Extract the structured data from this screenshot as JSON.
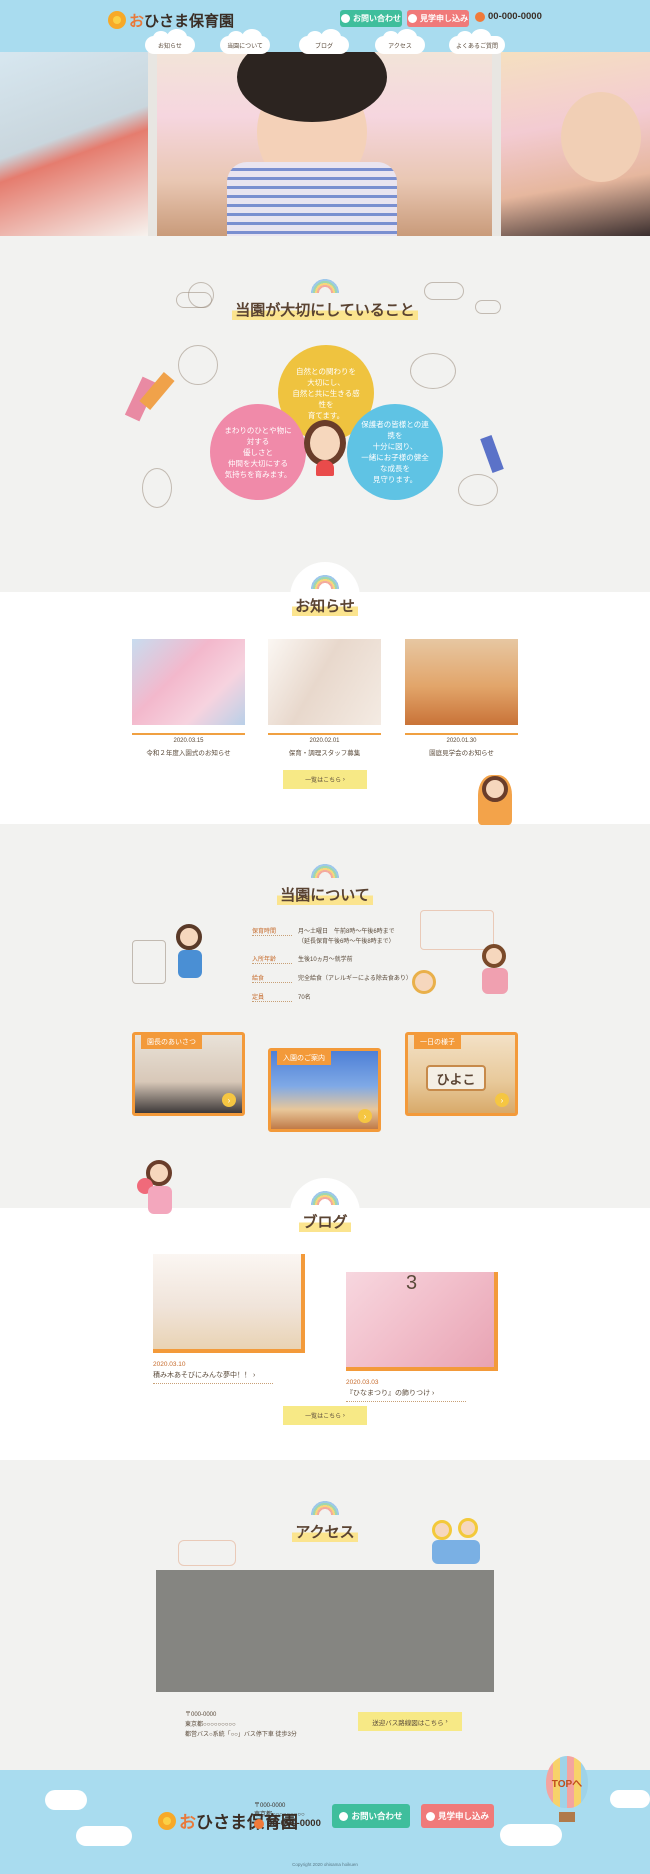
{
  "header": {
    "logo_prefix": "お",
    "logo_rest": "ひさま保育園",
    "contact_label": "お問い合わせ",
    "visit_label": "見学申し込み",
    "tel": "00-000-0000"
  },
  "nav": {
    "items": [
      {
        "label": "お知らせ"
      },
      {
        "label": "当園について"
      },
      {
        "label": "ブログ"
      },
      {
        "label": "アクセス"
      },
      {
        "label": "よくあるご質問"
      }
    ]
  },
  "values": {
    "title": "当園が大切にしていること",
    "yellow": "自然との関わりを\n大切にし、\n自然と共に生きる感性を\n育てます。",
    "pink": "まわりのひとや物に対する\n優しさと\n仲間を大切にする\n気持ちを育みます。",
    "blue": "保護者の皆様との連携を\n十分に図り、\n一緒にお子様の健全な成長を\n見守ります。"
  },
  "news": {
    "title": "お知らせ",
    "items": [
      {
        "date": "2020.03.15",
        "title": "令和２年度入園式のお知らせ"
      },
      {
        "date": "2020.02.01",
        "title": "保育・調理スタッフ募集"
      },
      {
        "date": "2020.01.30",
        "title": "園庭見学会のお知らせ"
      }
    ],
    "more_label": "一覧はこちら"
  },
  "about": {
    "title": "当園について",
    "rows": [
      {
        "key": "保育時間",
        "value": "月〜土曜日　午前8時〜午後6時まで"
      },
      {
        "key": "",
        "value": "（延長保育午後6時〜午後8時まで）"
      },
      {
        "key": "入所年齢",
        "value": "生後10ヵ月〜就学前"
      },
      {
        "key": "給食",
        "value": "完全給食（アレルギーによる除去食あり）"
      },
      {
        "key": "定員",
        "value": "70名"
      }
    ],
    "cards": [
      {
        "label": "園長のあいさつ"
      },
      {
        "label": "入園のご案内"
      },
      {
        "label": "一日の様子",
        "sign_text": "ひよこ"
      }
    ],
    "card_arrow": "›"
  },
  "blog": {
    "title": "ブログ",
    "items": [
      {
        "date": "2020.03.10",
        "title": "積み木あそびにみんな夢中！！"
      },
      {
        "date": "2020.03.03",
        "title": "『ひなまつり』の飾りつけ"
      }
    ],
    "more_label": "一覧はこちら",
    "calendar_number": "3"
  },
  "access": {
    "title": "アクセス",
    "postal": "〒000-0000",
    "address": "東京都○○○○○○○○○",
    "route": "都営バス○系統「○○」バス停下車 徒歩3分",
    "bus_label": "送迎バス路線図はこちら"
  },
  "footer": {
    "postal": "〒000-0000",
    "address": "東京都○○○○○○○○○",
    "tel": "00-000-0000",
    "contact_label": "お問い合わせ",
    "visit_label": "見学申し込み",
    "copyright": "Copyright 2020 ohisama hoikuen",
    "top_label": "TOPへ"
  },
  "colors": {
    "sky": "#a9dcef",
    "orange": "#f39a3a",
    "green_button": "#3fbe9c",
    "pink_button": "#f07a7a",
    "yellow_button": "#f7e986"
  }
}
